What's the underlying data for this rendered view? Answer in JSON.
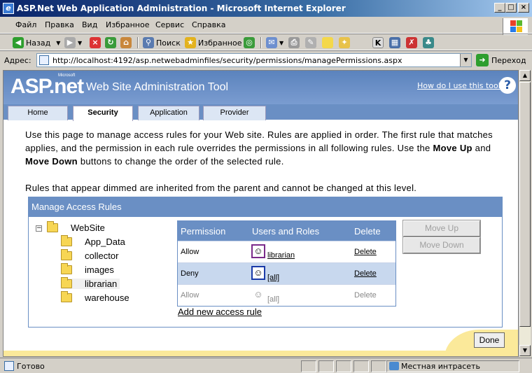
{
  "window": {
    "title": "ASP.Net Web Application Administration - Microsoft Internet Explorer"
  },
  "menubar": {
    "items": [
      "Файл",
      "Правка",
      "Вид",
      "Избранное",
      "Сервис",
      "Справка"
    ]
  },
  "toolbar": {
    "back_label": "Назад",
    "search_label": "Поиск",
    "favorites_label": "Избранное"
  },
  "address": {
    "label": "Адрес:",
    "url": "http://localhost:4192/asp.netwebadminfiles/security/permissions/managePermissions.aspx",
    "go_label": "Переход"
  },
  "header": {
    "logo_text": "ASP.net",
    "logo_ms": "Microsoft",
    "site_title": "Web Site Administration Tool",
    "help_link": "How do I use this tool?"
  },
  "tabs": [
    {
      "label": "Home",
      "active": false
    },
    {
      "label": "Security",
      "active": true
    },
    {
      "label": "Application",
      "active": false
    },
    {
      "label": "Provider",
      "active": false
    }
  ],
  "intro": {
    "line1": "Use this page to manage access rules for your Web site. Rules are applied in order. The first rule that matches applies, and the permission in each rule overrides the permissions in all following rules. Use the ",
    "move_up": "Move Up",
    "and": " and ",
    "move_down": "Move Down",
    "line1_end": " buttons to change the order of the selected rule.",
    "dimmed_note": "Rules that appear dimmed are inherited from the parent and cannot be changed at this level."
  },
  "panel": {
    "title": "Manage Access Rules",
    "tree": {
      "root": "WebSite",
      "children": [
        "App_Data",
        "collector",
        "images",
        "librarian",
        "warehouse"
      ]
    },
    "rules_table": {
      "headers": [
        "Permission",
        "Users and Roles",
        "Delete"
      ],
      "rows": [
        {
          "permission": "Allow",
          "user": "librarian",
          "delete": "Delete"
        },
        {
          "permission": "Deny",
          "user": "[all]",
          "delete": "Delete"
        },
        {
          "permission": "Allow",
          "user": "[all]",
          "delete": "Delete"
        }
      ]
    },
    "move_up_button": "Move Up",
    "move_down_button": "Move Down",
    "add_rule_link": "Add new access rule"
  },
  "done_button": "Done",
  "status": {
    "text": "Готово",
    "zone": "Местная интрасеть"
  }
}
